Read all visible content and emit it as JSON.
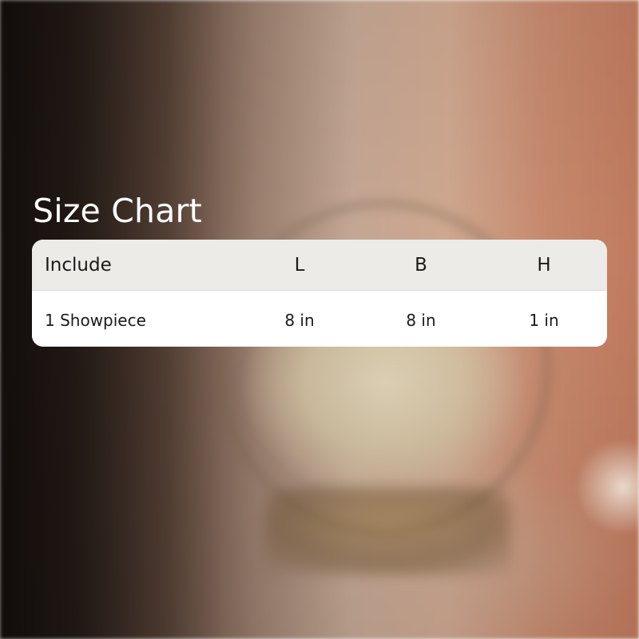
{
  "title": "Size Chart",
  "table": {
    "headers": [
      "Include",
      "L",
      "B",
      "H"
    ],
    "rows": [
      [
        "1 Showpiece",
        "8 in",
        "8 in",
        "1 in"
      ]
    ]
  },
  "colors": {
    "title_text": "#ffffff",
    "header_bg": "#ecebe7",
    "row_bg": "#ffffff",
    "cell_text": "#1a1a1a"
  }
}
